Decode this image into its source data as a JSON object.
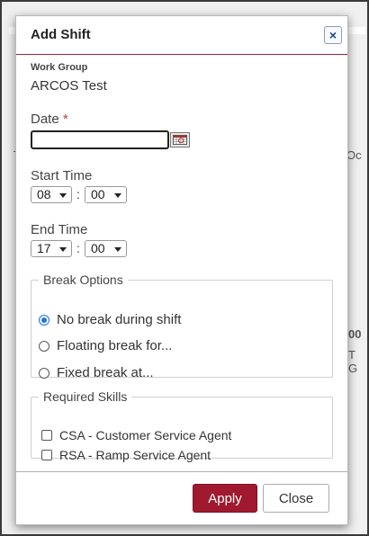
{
  "background": {
    "left_text": "T",
    "right_text_1": "Oc",
    "right_text_2": "00",
    "right_text_3": "T G"
  },
  "dialog": {
    "title": "Add Shift",
    "close_label": "×"
  },
  "work_group": {
    "label": "Work Group",
    "value": "ARCOS Test"
  },
  "date": {
    "label": "Date",
    "required_mark": "*",
    "value": "",
    "calendar_icon": "calendar-icon"
  },
  "start_time": {
    "label": "Start Time",
    "hour": "08",
    "separator": ":",
    "minute": "00"
  },
  "end_time": {
    "label": "End Time",
    "hour": "17",
    "separator": ":",
    "minute": "00"
  },
  "break_options": {
    "legend": "Break Options",
    "options": [
      {
        "label": "No break during shift",
        "selected": true
      },
      {
        "label": "Floating break for...",
        "selected": false
      },
      {
        "label": "Fixed break at...",
        "selected": false
      }
    ]
  },
  "required_skills": {
    "legend": "Required Skills",
    "skills": [
      {
        "label": "CSA - Customer Service Agent",
        "checked": false
      },
      {
        "label": "RSA - Ramp Service Agent",
        "checked": false
      }
    ]
  },
  "footer": {
    "apply_label": "Apply",
    "close_label": "Close"
  },
  "colors": {
    "accent": "#a0192f",
    "radio_selected": "#1a73e8"
  }
}
